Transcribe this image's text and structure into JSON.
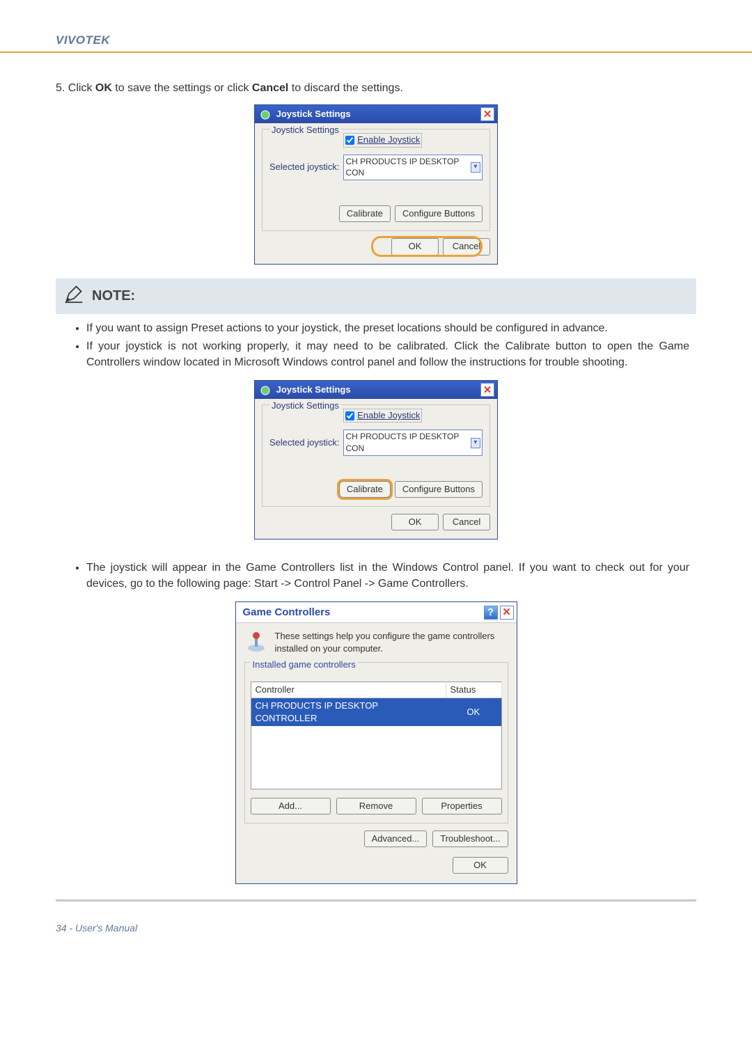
{
  "brand": "VIVOTEK",
  "step5": {
    "prefix": "5. Click ",
    "ok": "OK",
    "mid": " to save the settings or click ",
    "cancel": "Cancel",
    "suffix": " to discard the settings."
  },
  "joystick_dialog": {
    "title": "Joystick Settings",
    "fieldset_legend": "Joystick Settings",
    "enable_label": "Enable Joystick",
    "selected_label": "Selected joystick:",
    "selected_value": "CH PRODUCTS IP DESKTOP CON",
    "calibrate_btn": "Calibrate",
    "configure_btn": "Configure Buttons",
    "ok_btn": "OK",
    "cancel_btn": "Cancel"
  },
  "note": {
    "label": "NOTE:",
    "items": [
      "If you want to assign Preset actions to your joystick, the preset locations should be configured in advance.",
      "If your joystick is not working properly, it may need to be calibrated. Click the Calibrate button to open the Game Controllers window located in Microsoft Windows control panel and follow the instructions for trouble shooting.",
      "The joystick will appear in the Game Controllers list in the Windows Control panel. If you want to check out for your devices, go to the following page: Start -> Control Panel -> Game Controllers."
    ]
  },
  "game_controllers": {
    "title": "Game Controllers",
    "intro": "These settings help you configure the game controllers installed on your computer.",
    "fieldset_legend": "Installed game controllers",
    "col_controller": "Controller",
    "col_status": "Status",
    "row_name": "CH PRODUCTS IP DESKTOP CONTROLLER",
    "row_status": "OK",
    "add_btn": "Add...",
    "remove_btn": "Remove",
    "properties_btn": "Properties",
    "advanced_btn": "Advanced...",
    "troubleshoot_btn": "Troubleshoot...",
    "ok_btn": "OK"
  },
  "footer": "34 - User's Manual"
}
